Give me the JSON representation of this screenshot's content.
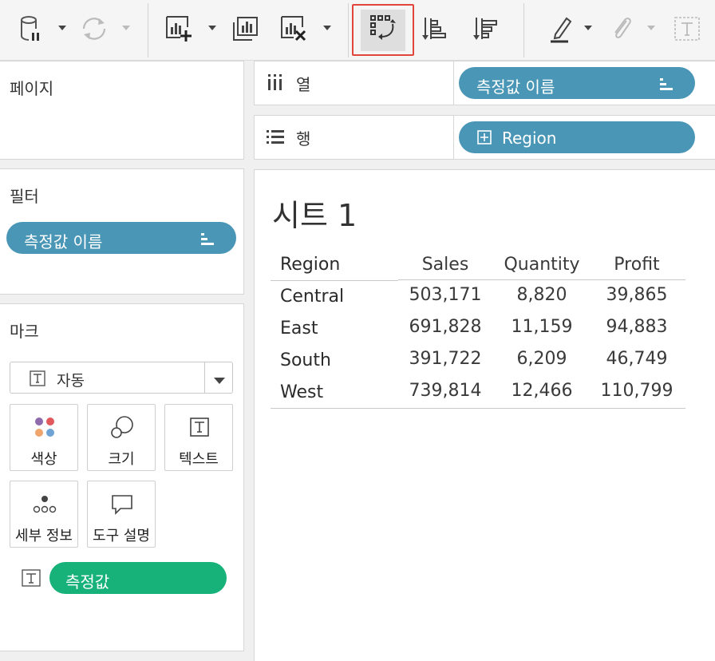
{
  "toolbar": {
    "buttons": [
      {
        "name": "datasource-pause",
        "icon": "database-pause-icon"
      },
      {
        "name": "refresh",
        "icon": "refresh-icon"
      },
      {
        "name": "new-worksheet",
        "icon": "new-worksheet-icon"
      },
      {
        "name": "duplicate-sheet",
        "icon": "duplicate-sheet-icon"
      },
      {
        "name": "clear-sheet",
        "icon": "clear-sheet-icon"
      },
      {
        "name": "swap-rows-columns",
        "icon": "swap-icon",
        "selected": true
      },
      {
        "name": "sort-ascending",
        "icon": "sort-ascending-icon"
      },
      {
        "name": "sort-descending",
        "icon": "sort-descending-icon"
      },
      {
        "name": "highlight",
        "icon": "highlighter-icon"
      },
      {
        "name": "attach",
        "icon": "paperclip-icon"
      },
      {
        "name": "text-label",
        "icon": "text-box-icon"
      }
    ],
    "highlight_color": "#e0463a"
  },
  "pages": {
    "title": "페이지"
  },
  "filters": {
    "title": "필터",
    "pills": [
      {
        "label": "측정값 이름"
      }
    ]
  },
  "marks": {
    "title": "마크",
    "type_selector": {
      "value": "자동"
    },
    "buttons": [
      {
        "label": "색상",
        "icon": "color-dots-icon"
      },
      {
        "label": "크기",
        "icon": "size-circles-icon"
      },
      {
        "label": "텍스트",
        "icon": "text-t-icon"
      },
      {
        "label": "세부 정보",
        "icon": "detail-dots-icon"
      },
      {
        "label": "도구 설명",
        "icon": "tooltip-bubble-icon"
      }
    ],
    "field_pill": {
      "label": "측정값",
      "color": "#16b279"
    }
  },
  "shelves": {
    "columns": {
      "label": "열",
      "pill": "측정값 이름"
    },
    "rows": {
      "label": "행",
      "pill": "Region"
    }
  },
  "colors": {
    "dimension_pill": "#4a96b6",
    "measure_pill": "#16b279"
  },
  "sheet": {
    "title": "시트 1",
    "table": {
      "row_header": "Region",
      "columns": [
        "Sales",
        "Quantity",
        "Profit"
      ],
      "rows": [
        {
          "region": "Central",
          "values": [
            "503,171",
            "8,820",
            "39,865"
          ]
        },
        {
          "region": "East",
          "values": [
            "691,828",
            "11,159",
            "94,883"
          ]
        },
        {
          "region": "South",
          "values": [
            "391,722",
            "6,209",
            "46,749"
          ]
        },
        {
          "region": "West",
          "values": [
            "739,814",
            "12,466",
            "110,799"
          ]
        }
      ]
    }
  }
}
